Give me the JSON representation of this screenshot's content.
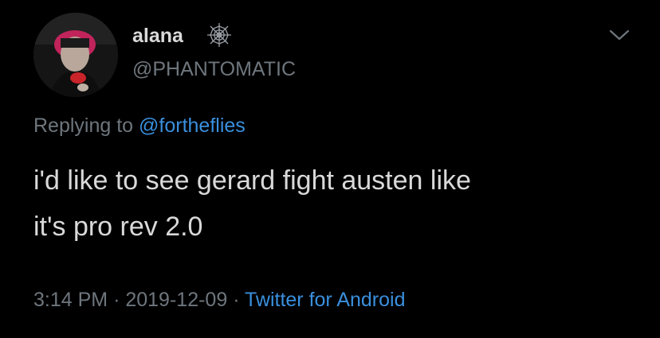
{
  "user": {
    "display_name": "alana",
    "handle": "@PHANTOMATIC",
    "name_badge_icon": "spider-web-icon",
    "avatar_icon": "profile-photo"
  },
  "menu": {
    "icon": "chevron-down-icon"
  },
  "reply": {
    "prefix": "Replying to",
    "mention": "@fortheflies"
  },
  "tweet": {
    "text_line1": "i'd like to see gerard fight austen like",
    "text_line2": "it's pro rev 2.0"
  },
  "meta": {
    "time": "3:14 PM",
    "separator1": "·",
    "date": "2019-12-09",
    "separator2": "·",
    "source": "Twitter for Android"
  },
  "colors": {
    "background": "#000000",
    "text": "#d9d9d9",
    "muted": "#6e767d",
    "link": "#3a8fdd"
  }
}
